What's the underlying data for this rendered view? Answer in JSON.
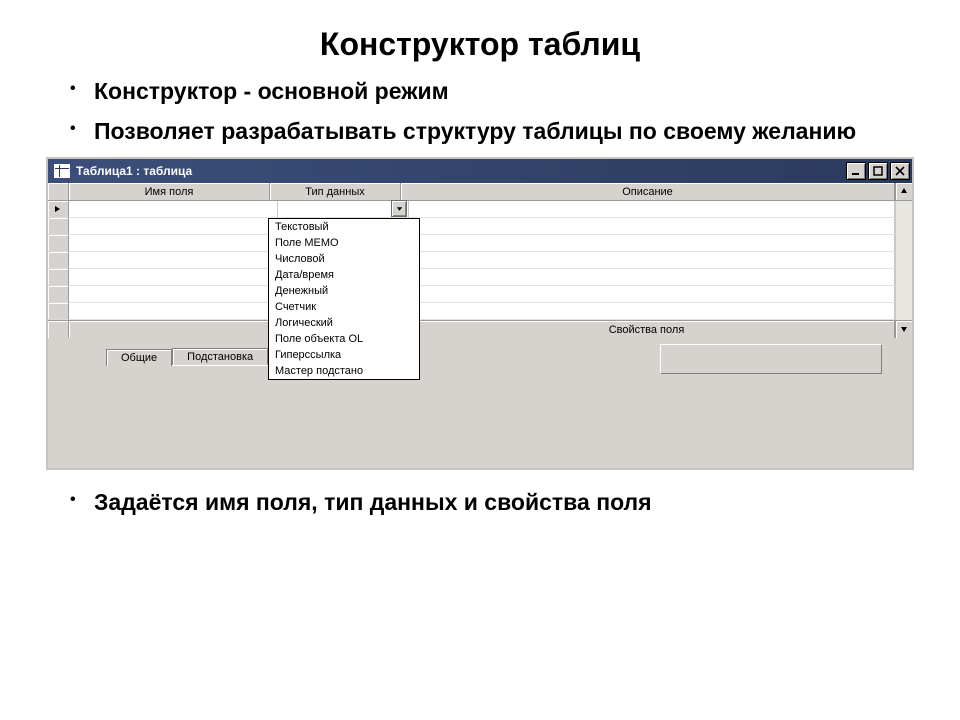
{
  "title": "Конструктор таблиц",
  "bullets_top": [
    "Конструктор - основной режим",
    "Позволяет разрабатывать структуру таблицы по своему желанию"
  ],
  "bullets_bottom": [
    "Задаётся имя поля, тип данных и свойства поля"
  ],
  "window": {
    "caption": "Таблица1 : таблица",
    "columns": {
      "name": "Имя поля",
      "type": "Тип данных",
      "desc": "Описание"
    },
    "properties_label": "Свойства поля",
    "tabs": {
      "general": "Общие",
      "lookup": "Подстановка"
    },
    "dropdown": [
      "Текстовый",
      "Поле MEMO",
      "Числовой",
      "Дата/время",
      "Денежный",
      "Счетчик",
      "Логический",
      "Поле объекта OL",
      "Гиперссылка",
      "Мастер подстано"
    ]
  }
}
